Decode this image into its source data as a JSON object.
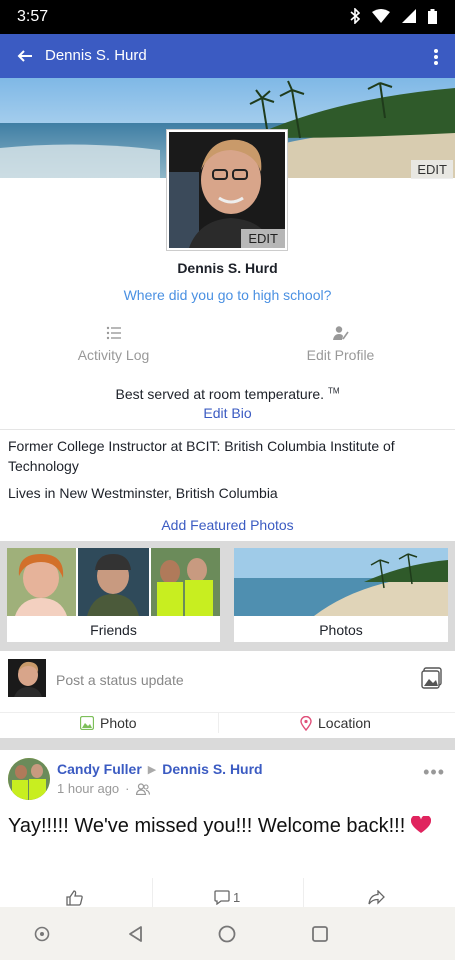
{
  "status_bar": {
    "time": "3:57"
  },
  "app_bar": {
    "title": "Dennis S. Hurd"
  },
  "cover": {
    "edit_label": "EDIT"
  },
  "avatar": {
    "edit_label": "EDIT"
  },
  "profile": {
    "name": "Dennis S. Hurd",
    "school_prompt": "Where did you go to high school?"
  },
  "actions": {
    "activity_log": "Activity Log",
    "edit_profile": "Edit Profile"
  },
  "bio": {
    "text": "Best served at room temperature.",
    "tm": "TM",
    "edit_label": "Edit Bio"
  },
  "info": {
    "work": "Former College Instructor at BCIT: British Columbia Institute of Technology",
    "lives": "Lives in New Westminster, British Columbia"
  },
  "featured": {
    "add_label": "Add Featured Photos"
  },
  "cards": {
    "friends": "Friends",
    "photos": "Photos"
  },
  "composer": {
    "placeholder": "Post a status update",
    "photo_label": "Photo",
    "location_label": "Location"
  },
  "post": {
    "author": "Candy Fuller",
    "target": "Dennis S. Hurd",
    "time": "1 hour ago",
    "body": "Yay!!!!! We've missed you!!! Welcome back!!!",
    "comment_count": "1"
  },
  "colors": {
    "brand": "#3b5bc2",
    "link": "#4a90e2",
    "heart": "#e0245e"
  }
}
